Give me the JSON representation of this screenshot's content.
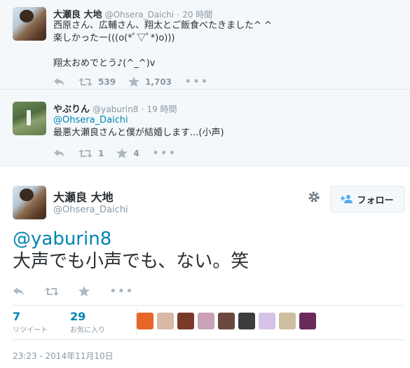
{
  "tweet1": {
    "name": "大瀬良 大地",
    "handle": "@Ohsera_Daichi",
    "sep": "·",
    "time": "20 時間",
    "lines": [
      "西原さん、広輔さん、翔太とご飯食べたきました^ ^",
      "楽しかったー(((o(*ﾟ▽ﾟ*)o)))",
      "",
      "翔太おめでとう♪(^_^)v"
    ],
    "retweets": "539",
    "favorites": "1,703",
    "more": "•••"
  },
  "tweet2": {
    "name": "やぶりん",
    "handle": "@yaburin8",
    "sep": "·",
    "time": "19 時間",
    "mention": "@Ohsera_Daichi",
    "text": "最悪大瀬良さんと僕が結婚します...(小声)",
    "retweets": "1",
    "favorites": "4",
    "more": "•••"
  },
  "main": {
    "name": "大瀬良 大地",
    "handle": "@Ohsera_Daichi",
    "follow_label": "フォロー",
    "mention": "@yaburin8",
    "text": "大声でも小声でも、ない。笑",
    "more": "•••",
    "retweets": "7",
    "retweets_label": "リツイート",
    "favorites": "29",
    "favorites_label": "お気に入り",
    "date": "23:23 - 2014年11月10日"
  },
  "colors": {
    "accent": "#0084b4",
    "icon": "#aab8c2",
    "muted": "#8899a6",
    "faces": [
      "#e8662a",
      "#d9b8a6",
      "#7a3a2a",
      "#c9a2b8",
      "#6a4a40",
      "#3d3d3d",
      "#d6c2e6",
      "#cdbfa0",
      "#6a2a5a"
    ]
  }
}
